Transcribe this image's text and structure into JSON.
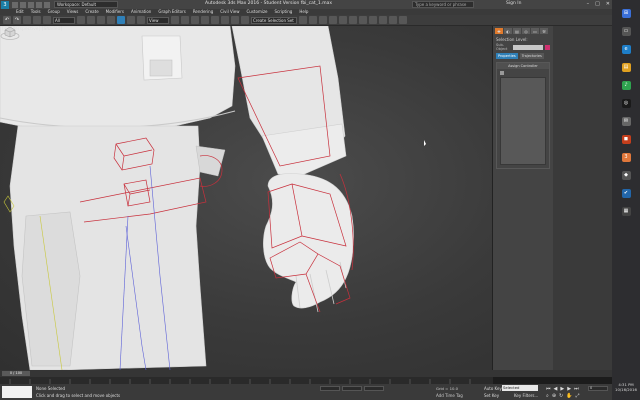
{
  "title_bar": {
    "app_logo": "3",
    "workspace": "Workspace: Default",
    "title": "Autodesk 3ds Max 2016 - Student Version    fbi_cat_1.max",
    "search_placeholder": "Type a keyword or phrase",
    "signin": "Sign In",
    "window_buttons": [
      "–",
      "□",
      "✕"
    ]
  },
  "menu": [
    "Edit",
    "Tools",
    "Group",
    "Views",
    "Create",
    "Modifiers",
    "Animation",
    "Graph Editors",
    "Rendering",
    "Civil View",
    "Customize",
    "Scripting",
    "Help"
  ],
  "toolbar": {
    "undo": "↶",
    "redo": "↷",
    "filter_value": "All",
    "ref_coord_value": "View",
    "named_sets_placeholder": "Create Selection Set"
  },
  "viewport": {
    "label": "[+] [Perspective] [Shaded]"
  },
  "command_panel": {
    "tabs": [
      "✚",
      "◐",
      "▤",
      "◎",
      "▭",
      "⚒"
    ],
    "selection_label": "Selection Level:",
    "name_label": "Sub-Object",
    "sub_buttons": [
      "Properties",
      "Trajectories"
    ],
    "rollout_title": "Assign Controller"
  },
  "timeline": {
    "slider": "0 / 100"
  },
  "status": {
    "selection": "None Selected",
    "prompt": "Click and drag to select and move objects",
    "grid": "Grid = 10.0",
    "add_time_tag": "Add Time Tag",
    "auto_key": "Auto Key",
    "auto_key_select": "Selected",
    "set_key": "Set Key",
    "key_filters": "Key Filters...",
    "frame": "0"
  },
  "taskbar": {
    "time": "4:31 PM",
    "date": "10/16/2016"
  }
}
